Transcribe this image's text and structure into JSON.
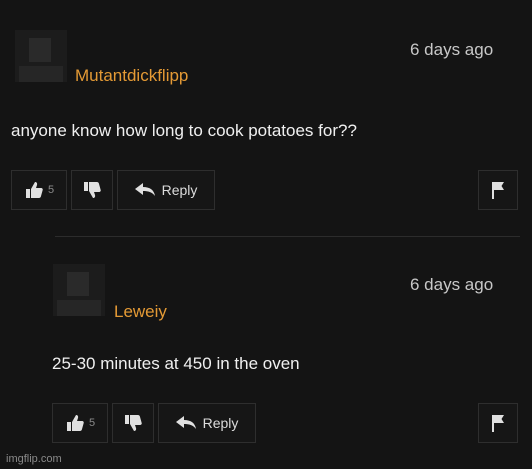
{
  "comments": [
    {
      "username": "Mutantdickflipp",
      "timestamp": "6 days ago",
      "text": "anyone know how long to cook potatoes for??",
      "likes": "5",
      "reply_label": "Reply",
      "avatar_icon": "user-silhouette-icon"
    },
    {
      "username": "Leweiy",
      "timestamp": "6 days ago",
      "text": "25-30 minutes at 450 in the oven",
      "likes": "5",
      "reply_label": "Reply",
      "avatar_icon": "user-silhouette-icon"
    }
  ],
  "watermark": "imgflip.com",
  "colors": {
    "background": "#141414",
    "username": "#e49a35",
    "text": "#f0f0f0",
    "timestamp": "#c8c8c8"
  },
  "icons": {
    "like": "thumbs-up-icon",
    "dislike": "thumbs-down-icon",
    "reply": "reply-arrow-icon",
    "report": "flag-icon"
  }
}
